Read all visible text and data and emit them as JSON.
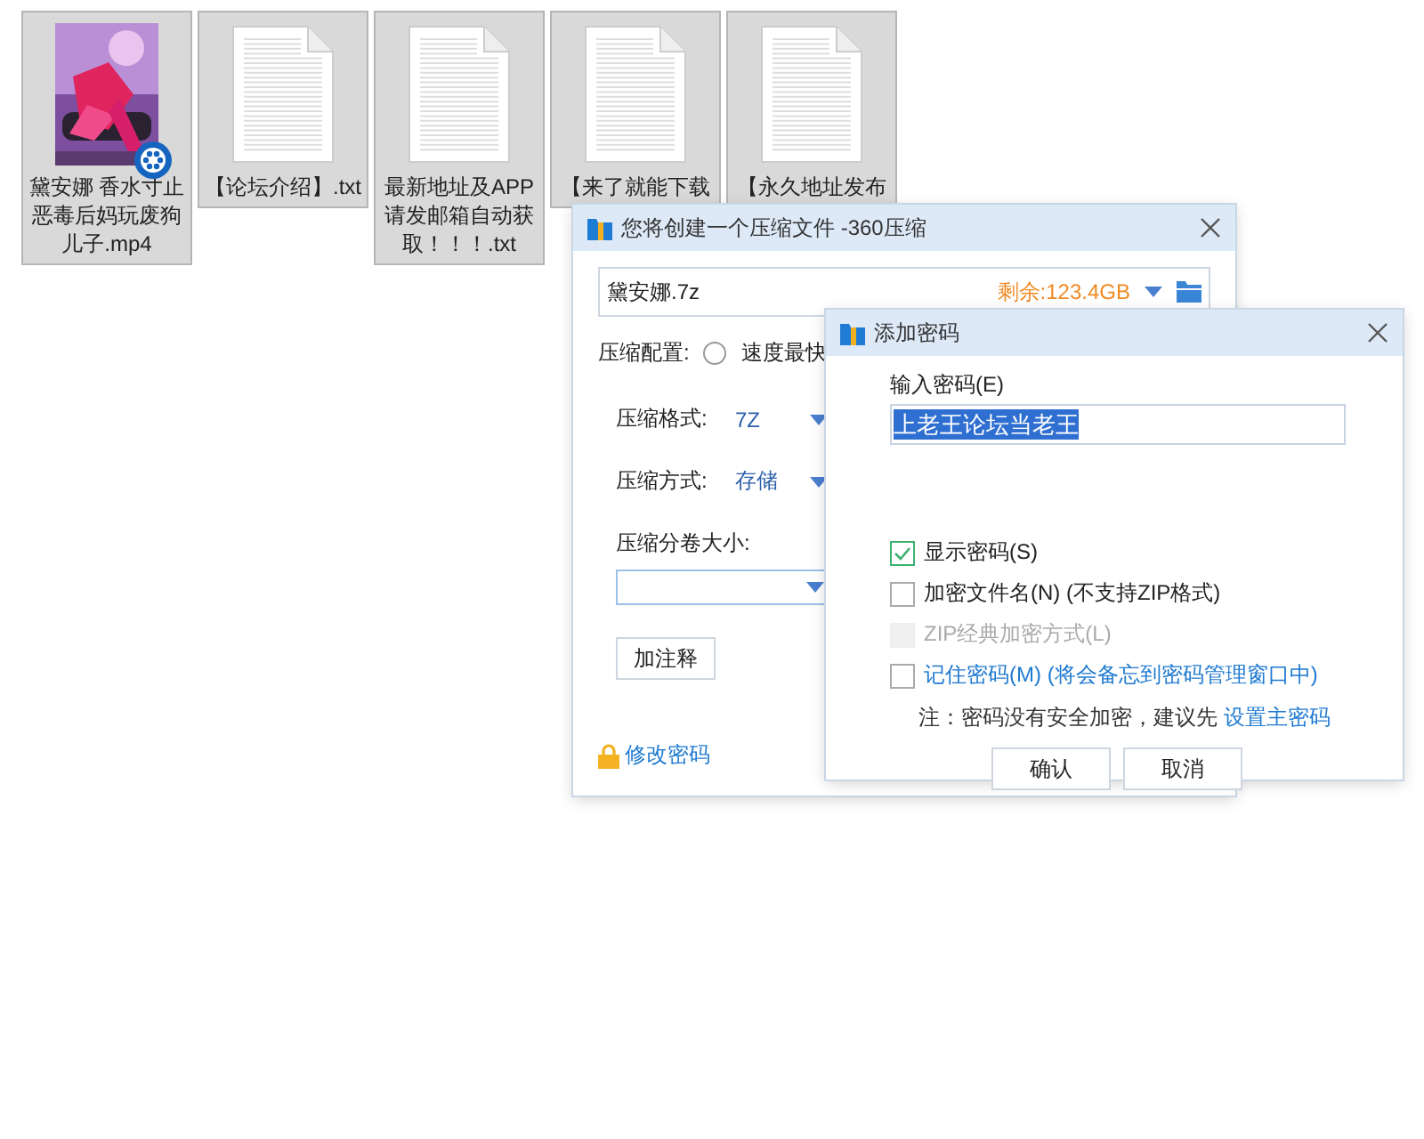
{
  "files": [
    {
      "kind": "video",
      "name": "黛安娜 香水寸止恶毒后妈玩废狗儿子.mp4"
    },
    {
      "kind": "text",
      "name": "【论坛介绍】.txt"
    },
    {
      "kind": "text",
      "name": "最新地址及APP请发邮箱自动获取！！！.txt"
    },
    {
      "kind": "text",
      "name": "【来了就能下载"
    },
    {
      "kind": "text",
      "name": "【永久地址发布"
    }
  ],
  "compress_dialog": {
    "title": "您将创建一个压缩文件 -360压缩",
    "filename": "黛安娜.7z",
    "free_space": "剩余:123.4GB",
    "config_label": "压缩配置:",
    "config_options": [
      {
        "label": "速度最快",
        "selected": false
      }
    ],
    "format_label": "压缩格式:",
    "format_value": "7Z",
    "method_label": "压缩方式:",
    "method_value": "存储",
    "split_label": "压缩分卷大小:",
    "comment_button": "加注释",
    "change_password_link": "修改密码"
  },
  "password_dialog": {
    "title": "添加密码",
    "password_label": "输入密码(E)",
    "password_value": "上老王论坛当老王",
    "options": [
      {
        "kind": "plain",
        "label": "显示密码(S)",
        "checked": true,
        "disabled": false
      },
      {
        "kind": "plain",
        "label": "加密文件名(N) (不支持ZIP格式)",
        "checked": false,
        "disabled": false
      },
      {
        "kind": "plain",
        "label": "ZIP经典加密方式(L)",
        "checked": false,
        "disabled": true
      },
      {
        "kind": "link",
        "label": "记住密码(M) (将会备忘到密码管理窗口中)",
        "checked": false,
        "disabled": false
      }
    ],
    "note": "注：密码没有安全加密，建议先",
    "note_link": "设置主密码",
    "buttons": [
      "确认",
      "取消"
    ]
  }
}
